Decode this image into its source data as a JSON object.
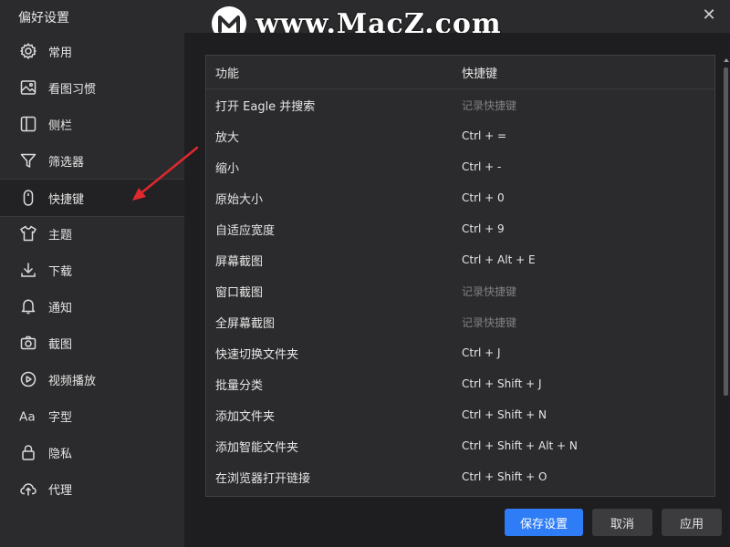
{
  "window": {
    "title": "偏好设置"
  },
  "watermark": {
    "text": "www.MacZ.com"
  },
  "sidebar": {
    "items": [
      {
        "label": "常用",
        "icon": "gear-icon"
      },
      {
        "label": "看图习惯",
        "icon": "image-icon"
      },
      {
        "label": "侧栏",
        "icon": "sidebar-icon"
      },
      {
        "label": "筛选器",
        "icon": "filter-icon"
      },
      {
        "label": "快捷键",
        "icon": "mouse-icon"
      },
      {
        "label": "主题",
        "icon": "shirt-icon"
      },
      {
        "label": "下载",
        "icon": "download-icon"
      },
      {
        "label": "通知",
        "icon": "bell-icon"
      },
      {
        "label": "截图",
        "icon": "camera-icon"
      },
      {
        "label": "视频播放",
        "icon": "play-icon"
      },
      {
        "label": "字型",
        "icon": "font-icon"
      },
      {
        "label": "隐私",
        "icon": "lock-icon"
      },
      {
        "label": "代理",
        "icon": "cloud-upload-icon"
      }
    ],
    "active_index": 4
  },
  "table": {
    "headers": {
      "function": "功能",
      "shortcut": "快捷键"
    },
    "rows": [
      {
        "function": "打开 Eagle 并搜索",
        "shortcut": "记录快捷键",
        "placeholder": true
      },
      {
        "function": "放大",
        "shortcut": "Ctrl + =",
        "placeholder": false
      },
      {
        "function": "缩小",
        "shortcut": "Ctrl + -",
        "placeholder": false
      },
      {
        "function": "原始大小",
        "shortcut": "Ctrl + 0",
        "placeholder": false
      },
      {
        "function": "自适应宽度",
        "shortcut": "Ctrl + 9",
        "placeholder": false
      },
      {
        "function": "屏幕截图",
        "shortcut": "Ctrl + Alt + E",
        "placeholder": false
      },
      {
        "function": "窗口截图",
        "shortcut": "记录快捷键",
        "placeholder": true
      },
      {
        "function": "全屏幕截图",
        "shortcut": "记录快捷键",
        "placeholder": true
      },
      {
        "function": "快速切换文件夹",
        "shortcut": "Ctrl + J",
        "placeholder": false
      },
      {
        "function": "批量分类",
        "shortcut": "Ctrl + Shift + J",
        "placeholder": false
      },
      {
        "function": "添加文件夹",
        "shortcut": "Ctrl + Shift + N",
        "placeholder": false
      },
      {
        "function": "添加智能文件夹",
        "shortcut": "Ctrl + Shift + Alt + N",
        "placeholder": false
      },
      {
        "function": "在浏览器打开链接",
        "shortcut": "Ctrl + Shift + O",
        "placeholder": false
      }
    ]
  },
  "footer": {
    "save_label": "保存设置",
    "cancel_label": "取消",
    "apply_label": "应用"
  },
  "colors": {
    "accent": "#2f7df6",
    "annotation_arrow": "#e0282e",
    "placeholder_text": "#808084"
  }
}
